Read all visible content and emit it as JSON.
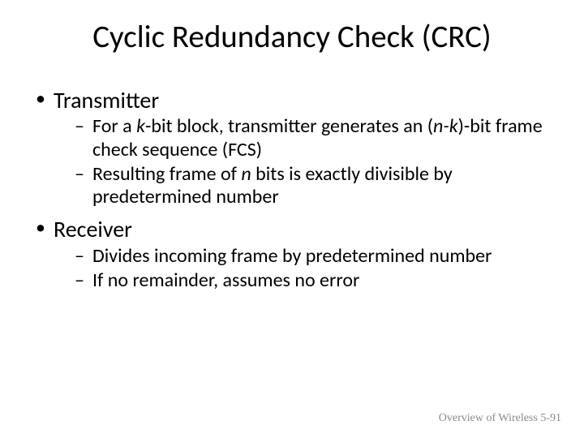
{
  "title": "Cyclic Redundancy Check (CRC)",
  "bullets": {
    "b1": {
      "label": "Transmitter"
    },
    "b1_1": {
      "t1": "For a ",
      "k": "k",
      "t2": "-bit block, transmitter generates an (",
      "nk": "n-k",
      "t3": ")-bit frame check sequence (FCS)"
    },
    "b1_2": {
      "t1": "Resulting frame of ",
      "n": "n",
      "t2": " bits is exactly divisible by predetermined number"
    },
    "b2": {
      "label": "Receiver"
    },
    "b2_1": {
      "text": "Divides incoming frame by predetermined number"
    },
    "b2_2": {
      "text": "If no remainder, assumes no error"
    }
  },
  "footer": "Overview of Wireless 5-91"
}
